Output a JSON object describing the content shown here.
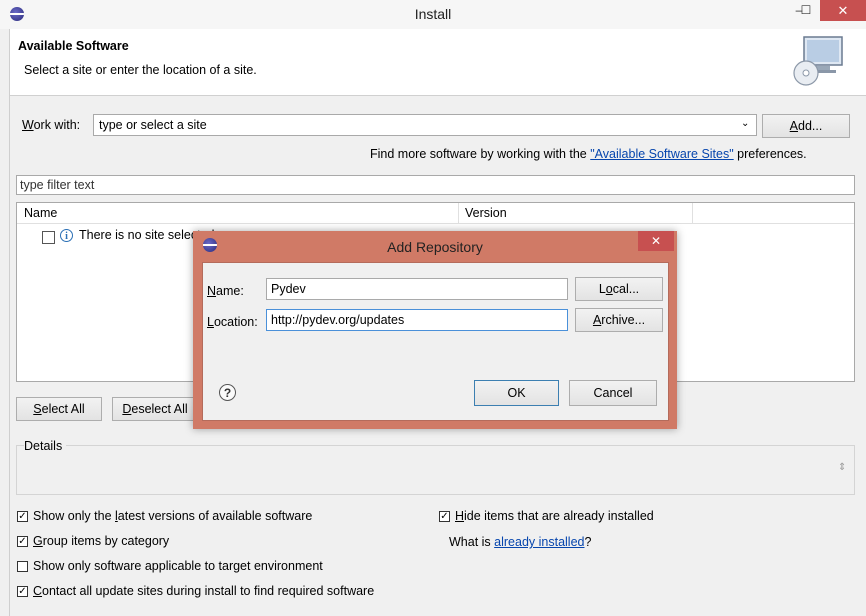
{
  "window": {
    "title": "Install",
    "minimize_glyph": "–",
    "maximize_glyph": "☐",
    "close_glyph": "✕"
  },
  "header": {
    "title": "Available Software",
    "subtitle": "Select a site or enter the location of a site.",
    "icon": "cd-monitor-icon"
  },
  "work_with": {
    "label_u": "W",
    "label_rest": "ork with:",
    "value": "type or select a site",
    "add_u": "A",
    "add_rest": "dd..."
  },
  "find_more": {
    "prefix": "Find more software by working with the ",
    "link": "\"Available Software Sites\"",
    "suffix": " preferences."
  },
  "filter": {
    "placeholder": "type filter text"
  },
  "table": {
    "columns": [
      "Name",
      "Version"
    ],
    "rows": [
      {
        "text": "There is no site selected.",
        "checked": false
      }
    ]
  },
  "buttons": {
    "select_all_u": "S",
    "select_all_rest": "elect All",
    "deselect_all_u": "D",
    "deselect_all_rest": "eselect All"
  },
  "details": {
    "label": "Details"
  },
  "options": {
    "latest_pre": "Show only the ",
    "latest_u": "l",
    "latest_post": "atest versions of available software",
    "group_u": "G",
    "group_post": "roup items by category",
    "target": "Show only software applicable to target environment",
    "contact_u": "C",
    "contact_post": "ontact all update sites during install to find required software",
    "hide_u": "H",
    "hide_post": "ide items that are already installed",
    "whatis_pre": "What is ",
    "whatis_link": "already installed",
    "whatis_post": "?"
  },
  "dialog": {
    "title": "Add Repository",
    "close_glyph": "✕",
    "name_label_u": "N",
    "name_label_rest": "ame:",
    "name_value": "Pydev",
    "local_pre": "L",
    "local_u": "o",
    "local_post": "cal...",
    "location_label_u": "L",
    "location_label_rest": "ocation:",
    "location_value": "http://pydev.org/updates",
    "archive_u": "A",
    "archive_rest": "rchive...",
    "help_glyph": "?",
    "ok_label": "OK",
    "cancel_label": "Cancel"
  },
  "colors": {
    "link": "#0645ad",
    "close_red": "#c75050",
    "dialog_border": "#d07a66"
  }
}
